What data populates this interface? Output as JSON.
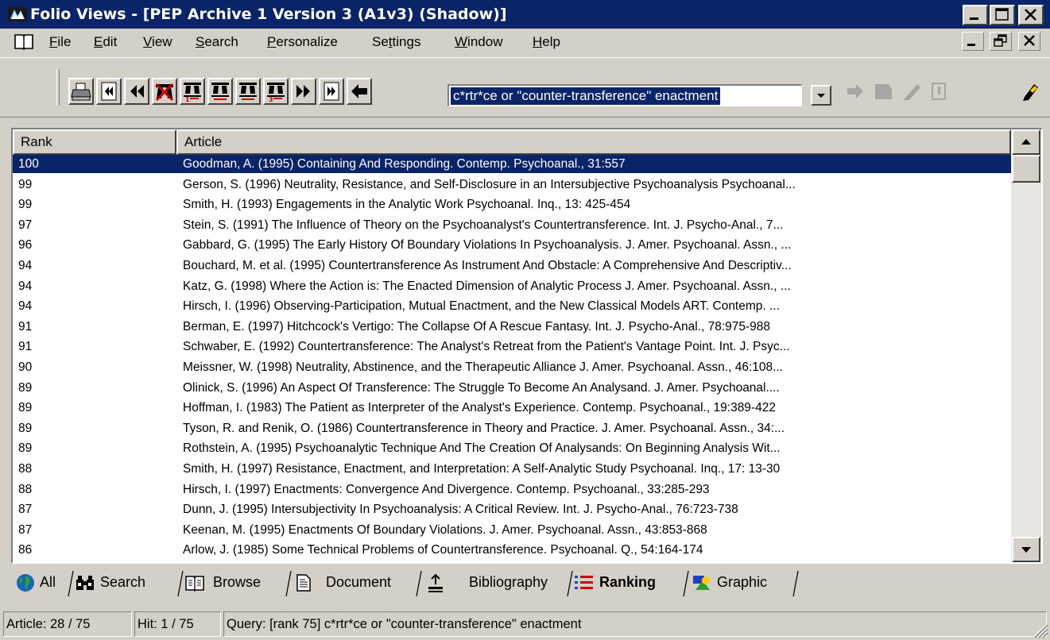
{
  "window": {
    "title": "Folio Views - [PEP Archive 1 Version 3 (A1v3) (Shadow)]",
    "controls": [
      "minimize",
      "maximize",
      "close"
    ]
  },
  "menu": {
    "items": [
      {
        "label": "File",
        "u": "F",
        "rest": "ile"
      },
      {
        "label": "Edit",
        "u": "E",
        "rest": "dit"
      },
      {
        "label": "View",
        "u": "V",
        "rest": "iew"
      },
      {
        "label": "Search",
        "u": "S",
        "rest": "earch"
      },
      {
        "label": "Personalize",
        "u": "P",
        "rest": "ersonalize"
      },
      {
        "label": "Settings",
        "pre": "Se",
        "u": "t",
        "rest": "tings"
      },
      {
        "label": "Window",
        "u": "W",
        "rest": "indow"
      },
      {
        "label": "Help",
        "u": "H",
        "rest": "elp"
      }
    ]
  },
  "toolbar": {
    "icons": [
      "printer-icon",
      "first-record-icon",
      "previous-record-icon",
      "clear-hits-icon",
      "first-hit-icon",
      "previous-hit-icon",
      "next-hit-icon",
      "next-record-icon",
      "last-record-icon",
      "back-icon"
    ],
    "query": "c*rtr*ce or \"counter-transference\" enactment",
    "right_icons": [
      "forward-icon",
      "bookmark-icon",
      "highlighter-icon",
      "note-icon",
      "pencil-icon"
    ]
  },
  "list": {
    "columns": {
      "rank": "Rank",
      "article": "Article"
    },
    "rows": [
      {
        "rank": "100",
        "article": "Goodman, A. (1995) Containing And Responding.  Contemp. Psychoanal., 31:557",
        "selected": true
      },
      {
        "rank": "99",
        "article": "Gerson, S. (1996) Neutrality, Resistance, and Self-Disclosure in an Intersubjective Psychoanalysis Psychoanal..."
      },
      {
        "rank": "99",
        "article": "Smith, H. (1993) Engagements in the Analytic Work Psychoanal. Inq., 13: 425-454"
      },
      {
        "rank": "97",
        "article": "Stein, S. (1991) The Influence of Theory on the Psychoanalyst's Countertransference.  Int. J. Psycho-Anal., 7..."
      },
      {
        "rank": "96",
        "article": "Gabbard, G. (1995) The Early History Of Boundary Violations In Psychoanalysis.  J. Amer. Psychoanal. Assn., ..."
      },
      {
        "rank": "94",
        "article": "Bouchard, M. et al. (1995) Countertransference As Instrument And Obstacle: A Comprehensive And Descriptiv..."
      },
      {
        "rank": "94",
        "article": "Katz, G. (1998) Where the Action is: The Enacted Dimension of Analytic Process J. Amer. Psychoanal. Assn., ..."
      },
      {
        "rank": "94",
        "article": "Hirsch, I. (1996) Observing-Participation, Mutual Enactment, and the New Classical Models ART.  Contemp. ..."
      },
      {
        "rank": "91",
        "article": "Berman, E. (1997) Hitchcock's Vertigo: The Collapse Of A Rescue Fantasy.  Int. J. Psycho-Anal., 78:975-988"
      },
      {
        "rank": "91",
        "article": "Schwaber, E. (1992) Countertransference: The Analyst's Retreat from the Patient's Vantage Point.  Int. J. Psyc..."
      },
      {
        "rank": "90",
        "article": "Meissner, W. (1998) Neutrality, Abstinence, and the Therapeutic Alliance J. Amer. Psychoanal. Assn., 46:108..."
      },
      {
        "rank": "89",
        "article": "Olinick, S. (1996) An Aspect Of Transference: The Struggle To Become An Analysand.  J. Amer. Psychoanal...."
      },
      {
        "rank": "89",
        "article": "Hoffman, I. (1983) The Patient as Interpreter of the Analyst's Experience.  Contemp. Psychoanal., 19:389-422"
      },
      {
        "rank": "89",
        "article": "Tyson, R. and Renik, O. (1986) Countertransference in Theory and Practice.  J. Amer. Psychoanal. Assn., 34:..."
      },
      {
        "rank": "89",
        "article": "Rothstein, A. (1995) Psychoanalytic Technique And The Creation Of Analysands: On Beginning Analysis Wit..."
      },
      {
        "rank": "88",
        "article": "Smith, H. (1997) Resistance, Enactment, and Interpretation: A Self-Analytic Study Psychoanal. Inq., 17: 13-30"
      },
      {
        "rank": "88",
        "article": "Hirsch, I. (1997) Enactments: Convergence And Divergence.  Contemp. Psychoanal., 33:285-293"
      },
      {
        "rank": "87",
        "article": "Dunn, J. (1995) Intersubjectivity In Psychoanalysis: A Critical Review.  Int. J. Psycho-Anal., 76:723-738"
      },
      {
        "rank": "87",
        "article": "Keenan, M. (1995) Enactments Of Boundary Violations.  J. Amer. Psychoanal. Assn., 43:853-868"
      },
      {
        "rank": "86",
        "article": "Arlow, J. (1985) Some Technical Problems of Countertransference.  Psychoanal. Q., 54:164-174"
      }
    ]
  },
  "tabs": [
    {
      "label": "All",
      "icon": "globe-icon"
    },
    {
      "label": "Search",
      "icon": "binoculars-icon"
    },
    {
      "label": "Browse",
      "icon": "open-book-icon"
    },
    {
      "label": "Document",
      "icon": "document-icon"
    },
    {
      "label": "Bibliography",
      "icon": "bibliography-icon"
    },
    {
      "label": "Ranking",
      "icon": "ranking-list-icon",
      "active": true
    },
    {
      "label": "Graphic",
      "icon": "graphic-icon"
    }
  ],
  "status": {
    "article": "Article: 28 / 75",
    "hit": "Hit: 1 / 75",
    "query": "Query: [rank 75] c*rtr*ce or \"counter-transference\" enactment"
  }
}
